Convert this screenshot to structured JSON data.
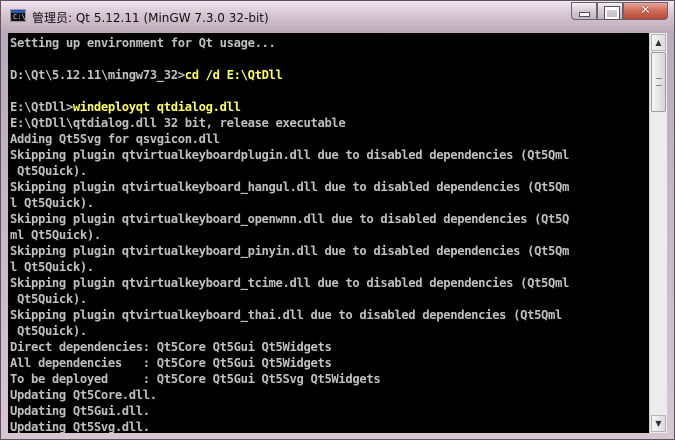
{
  "window": {
    "title": "管理员: Qt 5.12.11 (MinGW 7.3.0 32-bit)",
    "app_icon": "console-icon",
    "app_icon_text": "C:\\",
    "buttons": {
      "minimize": "minimize-icon",
      "maximize": "maximize-icon",
      "close_glyph": "✕"
    }
  },
  "console": {
    "text_color": "#c0c0c0",
    "command_color": "#ffff55",
    "lines": [
      {
        "text": "Setting up environment for Qt usage..."
      },
      {
        "text": ""
      },
      {
        "prompt": "D:\\Qt\\5.12.11\\mingw73_32>",
        "command": "cd /d E:\\QtDll"
      },
      {
        "text": ""
      },
      {
        "prompt": "E:\\QtDll>",
        "command": "windeployqt qtdialog.dll"
      },
      {
        "text": "E:\\QtDll\\qtdialog.dll 32 bit, release executable"
      },
      {
        "text": "Adding Qt5Svg for qsvgicon.dll"
      },
      {
        "text": "Skipping plugin qtvirtualkeyboardplugin.dll due to disabled dependencies (Qt5Qml"
      },
      {
        "text": " Qt5Quick)."
      },
      {
        "text": "Skipping plugin qtvirtualkeyboard_hangul.dll due to disabled dependencies (Qt5Qm"
      },
      {
        "text": "l Qt5Quick)."
      },
      {
        "text": "Skipping plugin qtvirtualkeyboard_openwnn.dll due to disabled dependencies (Qt5Q"
      },
      {
        "text": "ml Qt5Quick)."
      },
      {
        "text": "Skipping plugin qtvirtualkeyboard_pinyin.dll due to disabled dependencies (Qt5Qm"
      },
      {
        "text": "l Qt5Quick)."
      },
      {
        "text": "Skipping plugin qtvirtualkeyboard_tcime.dll due to disabled dependencies (Qt5Qml"
      },
      {
        "text": " Qt5Quick)."
      },
      {
        "text": "Skipping plugin qtvirtualkeyboard_thai.dll due to disabled dependencies (Qt5Qml"
      },
      {
        "text": " Qt5Quick)."
      },
      {
        "text": "Direct dependencies: Qt5Core Qt5Gui Qt5Widgets"
      },
      {
        "text": "All dependencies   : Qt5Core Qt5Gui Qt5Widgets"
      },
      {
        "text": "To be deployed     : Qt5Core Qt5Gui Qt5Svg Qt5Widgets"
      },
      {
        "text": "Updating Qt5Core.dll."
      },
      {
        "text": "Updating Qt5Gui.dll."
      },
      {
        "text": "Updating Qt5Svg.dll."
      }
    ]
  },
  "scrollbar": {
    "up_arrow": "▲",
    "down_arrow": "▼"
  }
}
